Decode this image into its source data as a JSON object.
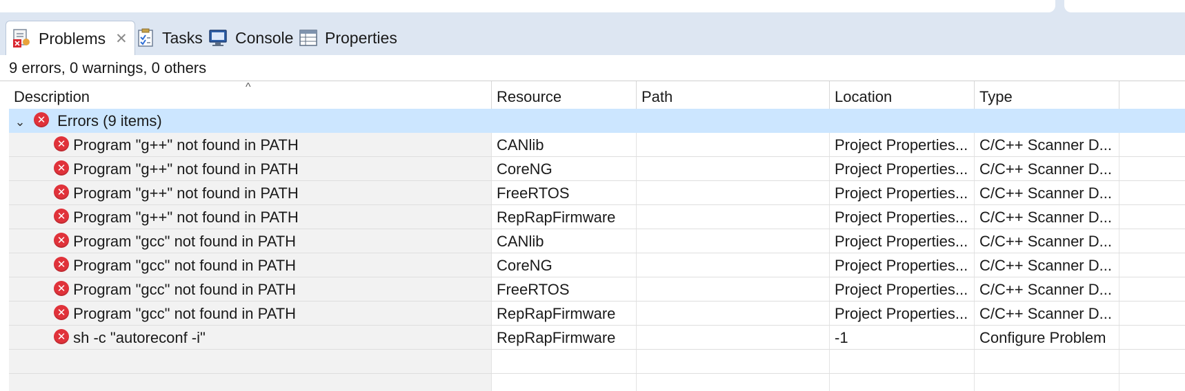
{
  "tabs": [
    {
      "label": "Problems",
      "icon": "problems-icon",
      "active": true,
      "closable": true
    },
    {
      "label": "Tasks",
      "icon": "tasks-icon",
      "active": false
    },
    {
      "label": "Console",
      "icon": "console-icon",
      "active": false
    },
    {
      "label": "Properties",
      "icon": "properties-icon",
      "active": false
    }
  ],
  "summary": "9 errors, 0 warnings, 0 others",
  "columns": {
    "description": "Description",
    "resource": "Resource",
    "path": "Path",
    "location": "Location",
    "type": "Type"
  },
  "group": {
    "label": "Errors (9 items)",
    "expanded": true
  },
  "rows": [
    {
      "description": "Program \"g++\" not found in PATH",
      "resource": "CANlib",
      "path": "",
      "location": "Project Properties...",
      "type": "C/C++ Scanner D..."
    },
    {
      "description": "Program \"g++\" not found in PATH",
      "resource": "CoreNG",
      "path": "",
      "location": "Project Properties...",
      "type": "C/C++ Scanner D..."
    },
    {
      "description": "Program \"g++\" not found in PATH",
      "resource": "FreeRTOS",
      "path": "",
      "location": "Project Properties...",
      "type": "C/C++ Scanner D..."
    },
    {
      "description": "Program \"g++\" not found in PATH",
      "resource": "RepRapFirmware",
      "path": "",
      "location": "Project Properties...",
      "type": "C/C++ Scanner D..."
    },
    {
      "description": "Program \"gcc\" not found in PATH",
      "resource": "CANlib",
      "path": "",
      "location": "Project Properties...",
      "type": "C/C++ Scanner D..."
    },
    {
      "description": "Program \"gcc\" not found in PATH",
      "resource": "CoreNG",
      "path": "",
      "location": "Project Properties...",
      "type": "C/C++ Scanner D..."
    },
    {
      "description": "Program \"gcc\" not found in PATH",
      "resource": "FreeRTOS",
      "path": "",
      "location": "Project Properties...",
      "type": "C/C++ Scanner D..."
    },
    {
      "description": "Program \"gcc\" not found in PATH",
      "resource": "RepRapFirmware",
      "path": "",
      "location": "Project Properties...",
      "type": "C/C++ Scanner D..."
    },
    {
      "description": "sh -c \"autoreconf -i\"",
      "resource": "RepRapFirmware",
      "path": "",
      "location": "-1",
      "type": "Configure Problem"
    }
  ],
  "colors": {
    "tabbar_bg": "#dde6f2",
    "group_row_bg": "#cce6ff",
    "error_icon": "#e0323a"
  }
}
